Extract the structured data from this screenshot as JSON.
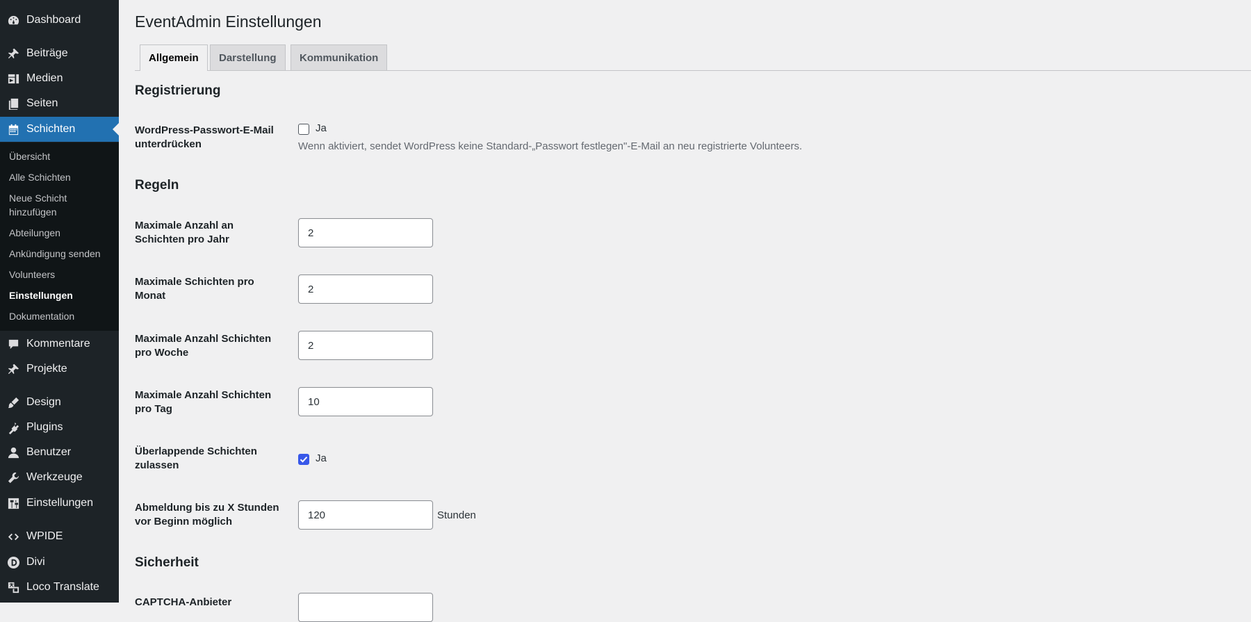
{
  "sidebar": {
    "items": [
      {
        "label": "Dashboard",
        "icon": "dashboard-icon"
      },
      {
        "label": "Beiträge",
        "icon": "pin-icon"
      },
      {
        "label": "Medien",
        "icon": "media-icon"
      },
      {
        "label": "Seiten",
        "icon": "pages-icon"
      },
      {
        "label": "Schichten",
        "icon": "calendar-icon"
      },
      {
        "label": "Kommentare",
        "icon": "comment-icon"
      },
      {
        "label": "Projekte",
        "icon": "pin-icon"
      },
      {
        "label": "Design",
        "icon": "brush-icon"
      },
      {
        "label": "Plugins",
        "icon": "plugin-icon"
      },
      {
        "label": "Benutzer",
        "icon": "user-icon"
      },
      {
        "label": "Werkzeuge",
        "icon": "wrench-icon"
      },
      {
        "label": "Einstellungen",
        "icon": "settings-icon"
      },
      {
        "label": "WPIDE",
        "icon": "code-icon"
      },
      {
        "label": "Divi",
        "icon": "divi-icon"
      },
      {
        "label": "Loco Translate",
        "icon": "translate-icon"
      }
    ],
    "submenu": [
      "Übersicht",
      "Alle Schichten",
      "Neue Schicht hinzufügen",
      "Abteilungen",
      "Ankündigung senden",
      "Volunteers",
      "Einstellungen",
      "Dokumentation"
    ]
  },
  "page": {
    "title": "EventAdmin Einstellungen",
    "tabs": [
      "Allgemein",
      "Darstellung",
      "Kommunikation"
    ],
    "active_tab": "Allgemein"
  },
  "sections": {
    "registration": {
      "title": "Registrierung",
      "suppress_email": {
        "label": "WordPress-Passwort-E-Mail unterdrücken",
        "checkbox_label": "Ja",
        "checked": false,
        "description": "Wenn aktiviert, sendet WordPress keine Standard-„Passwort festlegen\"-E-Mail an neu registrierte Volunteers."
      }
    },
    "rules": {
      "title": "Regeln",
      "max_per_year": {
        "label": "Maximale Anzahl an Schichten pro Jahr",
        "value": "2"
      },
      "max_per_month": {
        "label": "Maximale Schichten pro Monat",
        "value": "2"
      },
      "max_per_week": {
        "label": "Maximale Anzahl Schichten pro Woche",
        "value": "2"
      },
      "max_per_day": {
        "label": "Maximale Anzahl Schichten pro Tag",
        "value": "10"
      },
      "overlap": {
        "label": "Überlappende Schichten zulassen",
        "checkbox_label": "Ja",
        "checked": true
      },
      "cancel_hours": {
        "label": "Abmeldung bis zu X Stunden vor Beginn möglich",
        "value": "120",
        "suffix": "Stunden"
      }
    },
    "security": {
      "title": "Sicherheit",
      "captcha": {
        "label": "CAPTCHA-Anbieter"
      }
    }
  },
  "colors": {
    "sidebar_bg": "#1d2327",
    "submenu_bg": "#101517",
    "accent": "#2271b1",
    "checkbox_checked": "#3858e9",
    "content_bg": "#f0f0f1"
  }
}
